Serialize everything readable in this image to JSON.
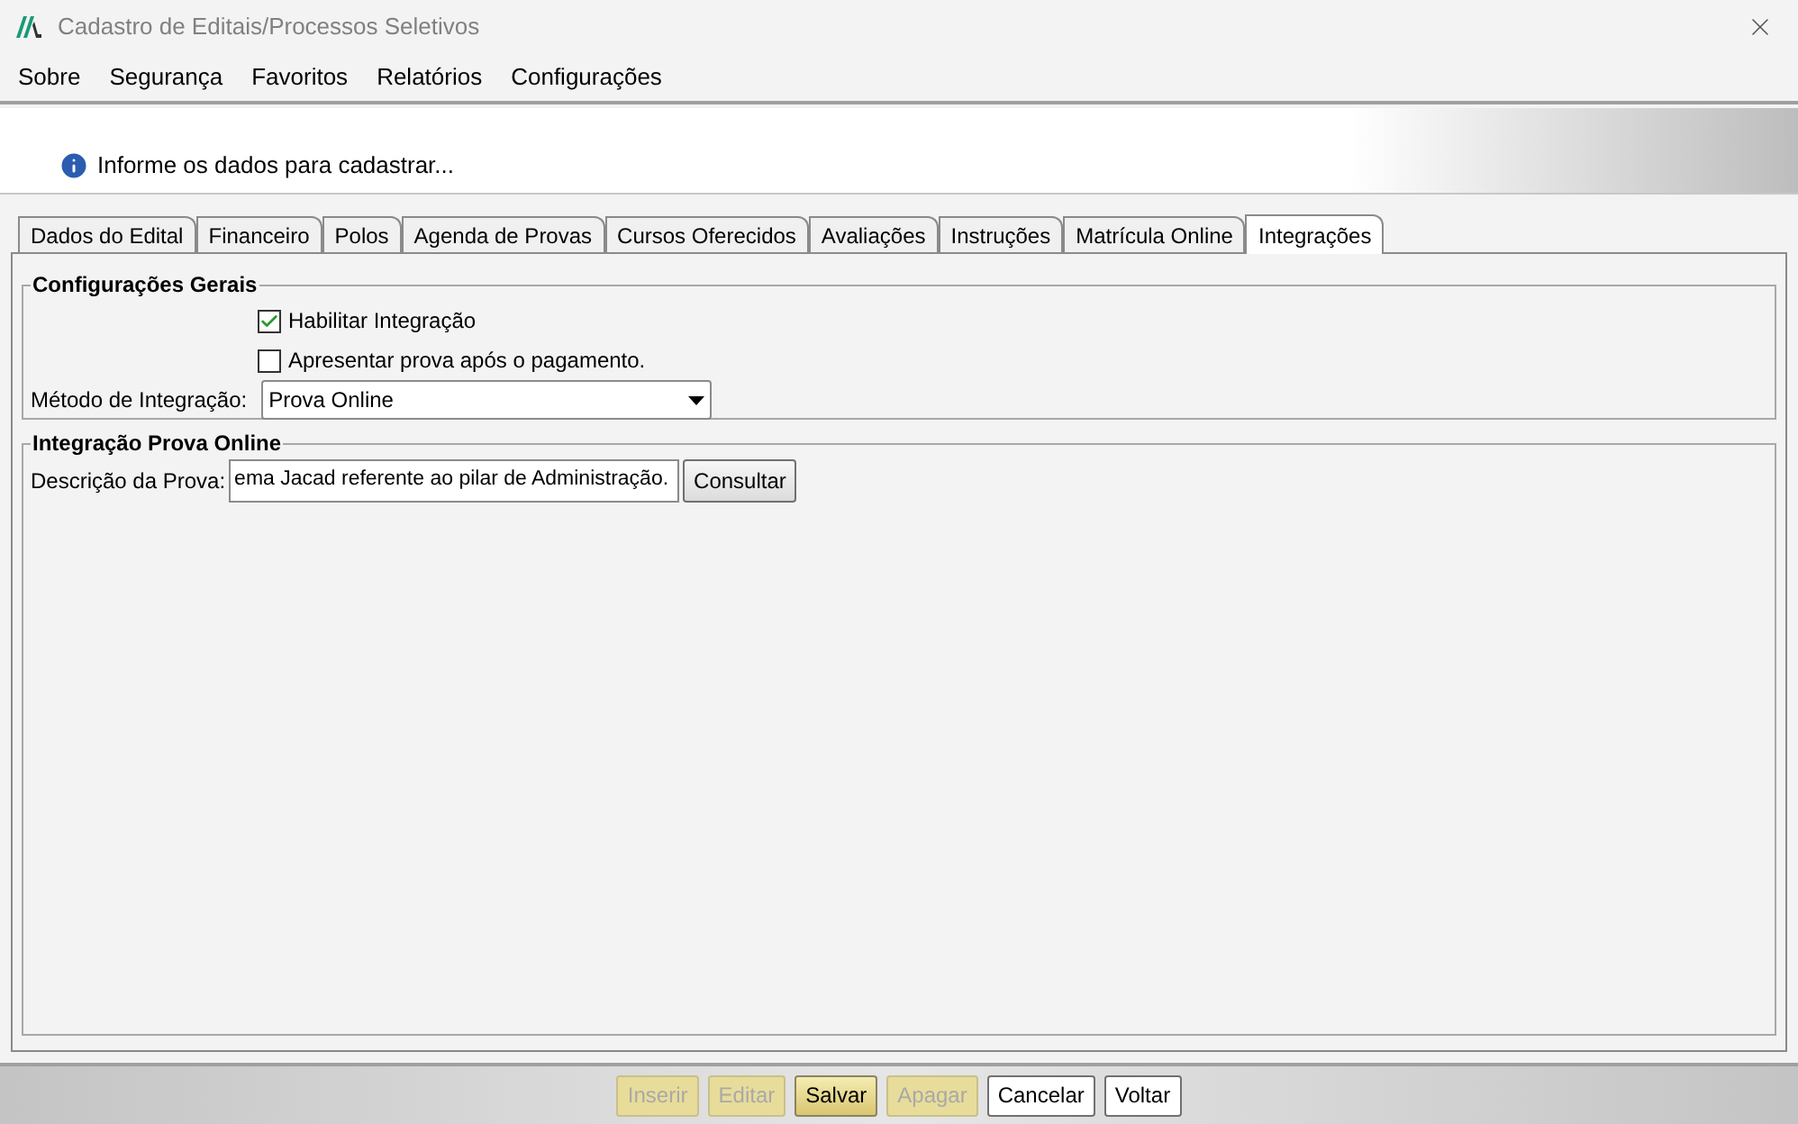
{
  "window": {
    "title": "Cadastro de Editais/Processos Seletivos"
  },
  "menu": [
    "Sobre",
    "Segurança",
    "Favoritos",
    "Relatórios",
    "Configurações"
  ],
  "info": "Informe os dados para cadastrar...",
  "tabs": [
    {
      "label": "Dados do Edital",
      "selected": false
    },
    {
      "label": "Financeiro",
      "selected": false
    },
    {
      "label": "Polos",
      "selected": false
    },
    {
      "label": "Agenda de Provas",
      "selected": false
    },
    {
      "label": "Cursos Oferecidos",
      "selected": false
    },
    {
      "label": "Avaliações",
      "selected": false
    },
    {
      "label": "Instruções",
      "selected": false
    },
    {
      "label": "Matrícula Online",
      "selected": false
    },
    {
      "label": "Integrações",
      "selected": true
    }
  ],
  "general": {
    "title": "Configurações Gerais",
    "checkboxes": [
      {
        "label": "Habilitar Integração",
        "checked": true
      },
      {
        "label": "Apresentar prova após o pagamento.",
        "checked": false
      }
    ],
    "method_label": "Método de Integração:",
    "method_value": "Prova Online"
  },
  "online": {
    "title": "Integração Prova Online",
    "label": "Descrição da Prova:",
    "value": "ema Jacad referente ao pilar de Administração.",
    "button": "Consultar"
  },
  "buttons": [
    {
      "label": "Inserir",
      "kind": "primary",
      "disabled": true
    },
    {
      "label": "Editar",
      "kind": "primary",
      "disabled": true
    },
    {
      "label": "Salvar",
      "kind": "primary",
      "disabled": false
    },
    {
      "label": "Apagar",
      "kind": "primary",
      "disabled": true
    },
    {
      "label": "Cancelar",
      "kind": "normal",
      "disabled": false
    },
    {
      "label": "Voltar",
      "kind": "normal",
      "disabled": false
    }
  ]
}
